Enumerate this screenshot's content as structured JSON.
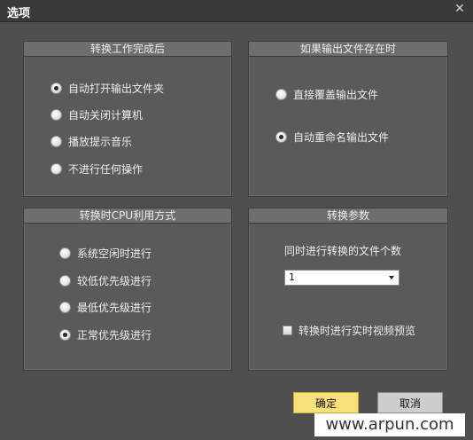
{
  "window": {
    "title": "选项"
  },
  "groups": {
    "after_convert": {
      "title": "转换工作完成后",
      "options": [
        {
          "label": "自动打开输出文件夹",
          "checked": true
        },
        {
          "label": "自动关闭计算机",
          "checked": false
        },
        {
          "label": "播放提示音乐",
          "checked": false
        },
        {
          "label": "不进行任何操作",
          "checked": false
        }
      ]
    },
    "file_exists": {
      "title": "如果输出文件存在时",
      "options": [
        {
          "label": "直接覆盖输出文件",
          "checked": false
        },
        {
          "label": "自动重命名输出文件",
          "checked": true
        }
      ]
    },
    "cpu_usage": {
      "title": "转换时CPU利用方式",
      "options": [
        {
          "label": "系统空闲时进行",
          "checked": false
        },
        {
          "label": "较低优先级进行",
          "checked": false
        },
        {
          "label": "最低优先级进行",
          "checked": false
        },
        {
          "label": "正常优先级进行",
          "checked": true
        }
      ]
    },
    "convert_params": {
      "title": "转换参数",
      "concurrent_label": "同时进行转换的文件个数",
      "concurrent_value": "1",
      "preview_label": "转换时进行实时视频预览",
      "preview_checked": false
    }
  },
  "buttons": {
    "ok": "确定",
    "cancel": "取消"
  },
  "watermark": "www.arpun.com"
}
